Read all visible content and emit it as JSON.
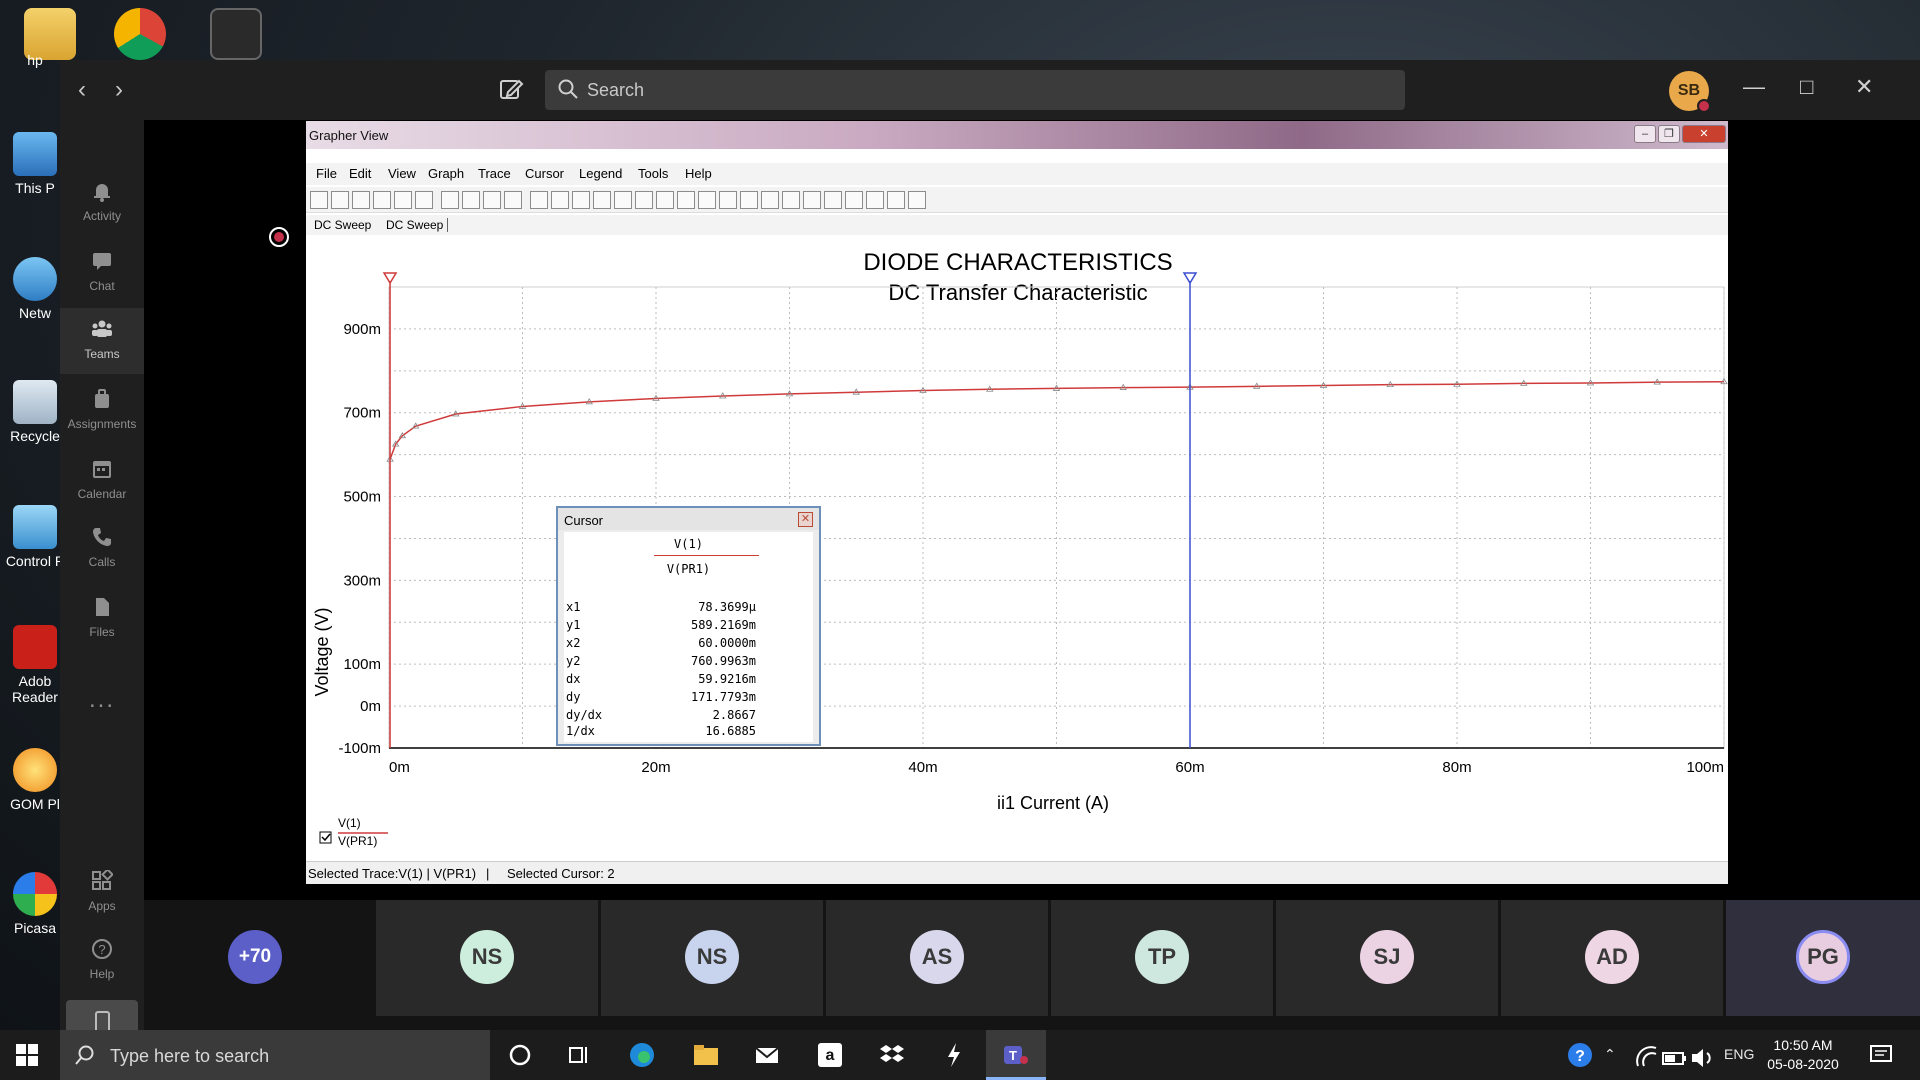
{
  "desktop": {
    "icons": [
      {
        "label": "hp"
      },
      {
        "label": "This P"
      },
      {
        "label": "Netw"
      },
      {
        "label": "Recycle"
      },
      {
        "label": "Control P"
      },
      {
        "label": "Adob Reader"
      },
      {
        "label": "GOM Pl"
      },
      {
        "label": "Picasa"
      }
    ]
  },
  "teams": {
    "search_placeholder": "Search",
    "user_initials": "SB",
    "rail": [
      {
        "label": "Activity",
        "icon": "bell-icon"
      },
      {
        "label": "Chat",
        "icon": "chat-icon"
      },
      {
        "label": "Teams",
        "icon": "teams-icon"
      },
      {
        "label": "Assignments",
        "icon": "assignments-icon"
      },
      {
        "label": "Calendar",
        "icon": "calendar-icon"
      },
      {
        "label": "Calls",
        "icon": "phone-icon"
      },
      {
        "label": "Files",
        "icon": "files-icon"
      },
      {
        "label": "Apps",
        "icon": "apps-icon"
      },
      {
        "label": "Help",
        "icon": "help-icon"
      }
    ],
    "more_label": "...",
    "participants": [
      {
        "initials": "+70",
        "color": "#5b5fc7"
      },
      {
        "initials": "NS",
        "color": "#cdeedd"
      },
      {
        "initials": "NS",
        "color": "#c8d4ee"
      },
      {
        "initials": "AS",
        "color": "#d9d7ec"
      },
      {
        "initials": "TP",
        "color": "#cfe8df"
      },
      {
        "initials": "SJ",
        "color": "#ecd3e4"
      },
      {
        "initials": "AD",
        "color": "#eed6e4"
      },
      {
        "initials": "PG",
        "color": "#e8cde0"
      }
    ]
  },
  "grapher": {
    "window_title": "Grapher View",
    "menu": [
      "File",
      "Edit",
      "View",
      "Graph",
      "Trace",
      "Cursor",
      "Legend",
      "Tools",
      "Help"
    ],
    "tabs": [
      "DC Sweep",
      "DC Sweep"
    ],
    "status": {
      "selected_trace": "Selected Trace:V(1) | V(PR1)",
      "separator": "|",
      "selected_cursor": "Selected Cursor: 2"
    },
    "legend": {
      "line1": "V(1)",
      "line2": "V(PR1)"
    },
    "cursor_panel": {
      "title": "Cursor",
      "trace1": "V(1)",
      "trace2": "V(PR1)",
      "rows": [
        {
          "k": "x1",
          "v": "78.3699μ"
        },
        {
          "k": "y1",
          "v": "589.2169m"
        },
        {
          "k": "x2",
          "v": "60.0000m"
        },
        {
          "k": "y2",
          "v": "760.9963m"
        },
        {
          "k": "dx",
          "v": "59.9216m"
        },
        {
          "k": "dy",
          "v": "171.7793m"
        },
        {
          "k": "dy/dx",
          "v": "2.8667"
        },
        {
          "k": "1/dx",
          "v": "16.6885"
        }
      ]
    }
  },
  "chart_data": {
    "type": "line",
    "title": "DIODE CHARACTERISTICS",
    "subtitle": "DC Transfer Characteristic",
    "xlabel": "ii1 Current (A)",
    "ylabel": "Voltage (V)",
    "xlim": [
      0,
      100
    ],
    "ylim": [
      -100,
      1000
    ],
    "x_unit": "mA",
    "x_tick_labels": [
      "0m",
      "20m",
      "40m",
      "60m",
      "80m",
      "100m"
    ],
    "x_ticks": [
      0,
      20,
      40,
      60,
      80,
      100
    ],
    "y_tick_labels": [
      "-100m",
      "0m",
      "100m",
      "300m",
      "500m",
      "700m",
      "900m"
    ],
    "y_ticks": [
      -100,
      0,
      100,
      300,
      500,
      700,
      900
    ],
    "grid": true,
    "cursors": [
      {
        "name": "cursor-1",
        "x": 0.078
      },
      {
        "name": "cursor-2",
        "x": 60
      }
    ],
    "series": [
      {
        "name": "V(1)",
        "color": "#d03a3a",
        "x": [
          0.08,
          0.5,
          1,
          2,
          5,
          10,
          15,
          20,
          25,
          30,
          35,
          40,
          45,
          50,
          55,
          60,
          65,
          70,
          75,
          80,
          85,
          90,
          95,
          100
        ],
        "y": [
          589,
          625,
          645,
          668,
          697,
          715,
          726,
          734,
          740,
          745,
          749,
          753,
          756,
          758,
          760,
          761,
          763,
          765,
          767,
          768,
          770,
          771,
          773,
          774
        ]
      }
    ]
  },
  "taskbar": {
    "search_placeholder": "Type here to search",
    "lang": "ENG",
    "time": "10:50 AM",
    "date": "05-08-2020"
  }
}
